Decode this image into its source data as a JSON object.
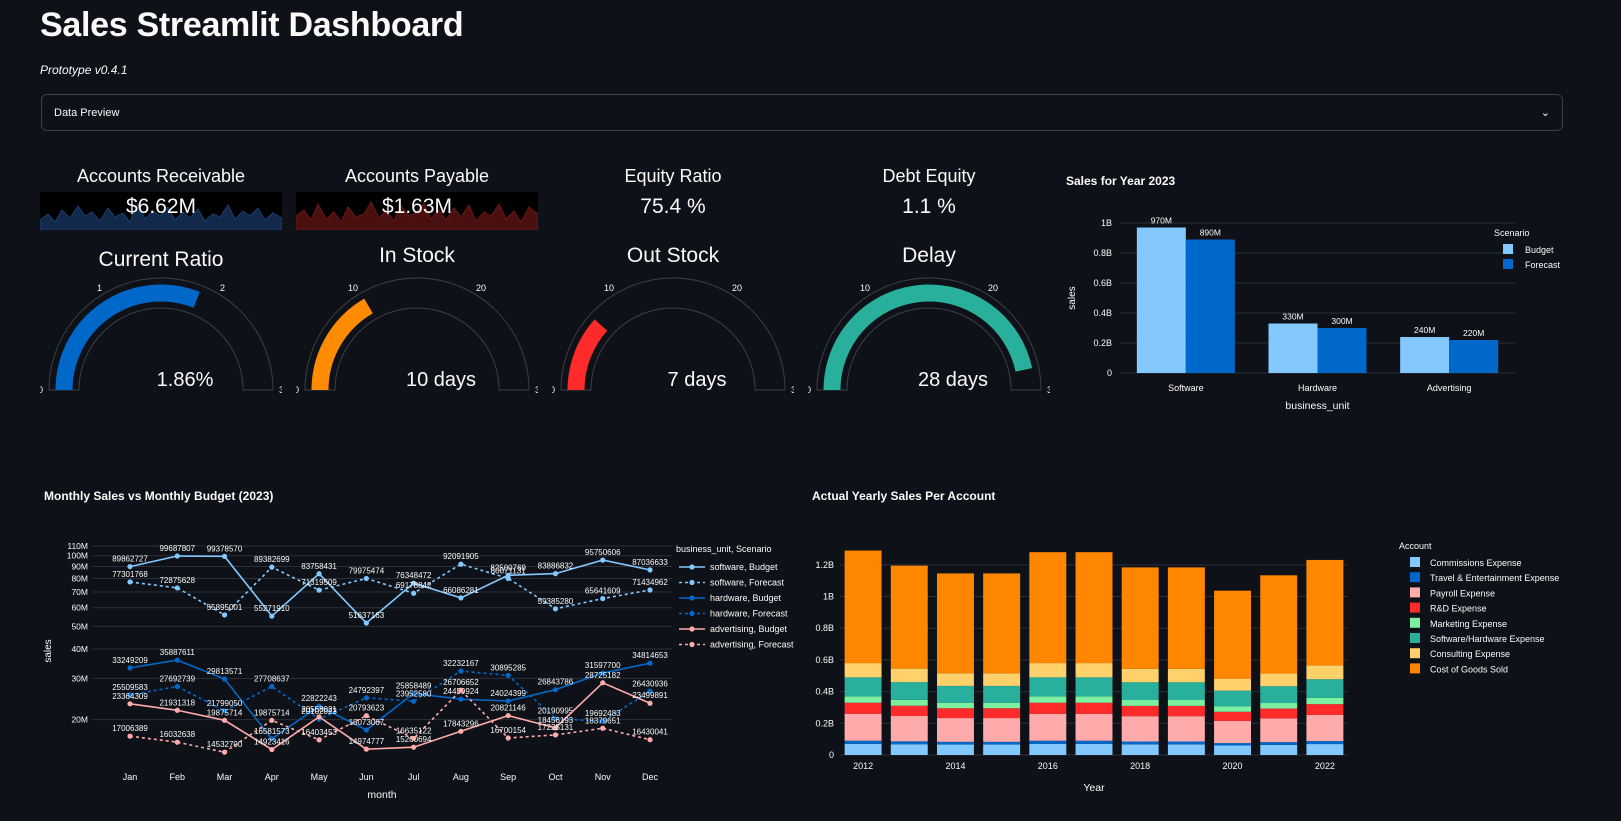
{
  "header": {
    "title": "Sales Streamlit Dashboard",
    "version": "Prototype v0.4.1",
    "expander_label": "Data Preview"
  },
  "kpis": [
    {
      "label": "Accounts Receivable",
      "value": "$6.62M",
      "spark_color": "#1f4e79"
    },
    {
      "label": "Accounts Payable",
      "value": "$1.63M",
      "spark_color": "#7a1a1a"
    },
    {
      "label": "Equity Ratio",
      "value": "75.4 %"
    },
    {
      "label": "Debt Equity",
      "value": "1.1 %"
    }
  ],
  "gauges": [
    {
      "title": "Current Ratio",
      "value_text": "1.86%",
      "value": 1.86,
      "max": 3,
      "color": "#0068c9",
      "ticks": [
        "0",
        "1",
        "2",
        "3"
      ]
    },
    {
      "title": "In Stock",
      "value_text": "10 days",
      "value": 10,
      "max": 30,
      "color": "#ff8c00",
      "ticks": [
        "0",
        "10",
        "20",
        "30"
      ]
    },
    {
      "title": "Out Stock",
      "value_text": "7 days",
      "value": 7,
      "max": 30,
      "color": "#ff2b2b",
      "ticks": [
        "0",
        "10",
        "20",
        "30"
      ]
    },
    {
      "title": "Delay",
      "value_text": "28 days",
      "value": 28,
      "max": 30,
      "color": "#29b09d",
      "ticks": [
        "0",
        "10",
        "20",
        "30"
      ]
    }
  ],
  "chart_data": [
    {
      "type": "bar",
      "title": "Sales for Year 2023",
      "xlabel": "business_unit",
      "ylabel": "sales",
      "categories": [
        "Software",
        "Hardware",
        "Advertising"
      ],
      "ylim": [
        0,
        1000000000
      ],
      "yticks": [
        "0",
        "0.2B",
        "0.4B",
        "0.6B",
        "0.8B",
        "1B"
      ],
      "legend_title": "Scenario",
      "series": [
        {
          "name": "Budget",
          "color": "#83c9ff",
          "values": [
            970000000,
            330000000,
            240000000
          ],
          "labels": [
            "970M",
            "330M",
            "240M"
          ]
        },
        {
          "name": "Forecast",
          "color": "#0068c9",
          "values": [
            890000000,
            300000000,
            220000000
          ],
          "labels": [
            "890M",
            "300M",
            "220M"
          ]
        }
      ]
    },
    {
      "type": "line",
      "title": "Monthly Sales vs Monthly Budget (2023)",
      "xlabel": "month",
      "ylabel": "sales",
      "scale": "log",
      "categories": [
        "Jan",
        "Feb",
        "Mar",
        "Apr",
        "May",
        "Jun",
        "Jul",
        "Aug",
        "Sep",
        "Oct",
        "Nov",
        "Dec"
      ],
      "yticks": [
        "20M",
        "30M",
        "40M",
        "50M",
        "60M",
        "70M",
        "80M",
        "90M",
        "100M",
        "110M"
      ],
      "ylim": [
        14000000,
        110000000
      ],
      "legend_title": "business_unit, Scenario",
      "series": [
        {
          "name": "software, Budget",
          "color": "#83c9ff",
          "dash": false,
          "values": [
            89862727,
            99687807,
            99378570,
            55271910,
            83758431,
            51637163,
            76348472,
            66086281,
            82500769,
            83886832,
            95750606,
            87036633
          ]
        },
        {
          "name": "software, Forecast",
          "color": "#83c9ff",
          "dash": true,
          "values": [
            77301768,
            72875628,
            55895001,
            89382699,
            71319509,
            79975474,
            69178842,
            92091905,
            80071131,
            59385280,
            65641609,
            71434962
          ]
        },
        {
          "name": "hardware, Budget",
          "color": "#0068c9",
          "dash": false,
          "values": [
            33249209,
            35887611,
            29813571,
            16581573,
            22822243,
            18073067,
            25858489,
            24459924,
            24024399,
            26843786,
            31597700,
            34814653
          ]
        },
        {
          "name": "hardware, Forecast",
          "color": "#0068c9",
          "dash": true,
          "values": [
            25509583,
            27692739,
            21799050,
            27708637,
            20102023,
            24792397,
            23952580,
            32232167,
            30895285,
            20190995,
            19692483,
            26430936
          ]
        },
        {
          "name": "advertising, Budget",
          "color": "#ffabab",
          "dash": false,
          "values": [
            23364309,
            21931318,
            19875714,
            14923416,
            20558021,
            14974777,
            15260694,
            17843296,
            20821146,
            18456193,
            28725182,
            23499891
          ]
        },
        {
          "name": "advertising, Forecast",
          "color": "#ffabab",
          "dash": true,
          "values": [
            17006389,
            16032638,
            14532700,
            19875714,
            16403453,
            20793623,
            16635122,
            26706652,
            16700154,
            17225131,
            18379651,
            16430041
          ]
        }
      ]
    },
    {
      "type": "bar",
      "stacked": true,
      "title": "Actual Yearly Sales Per Account",
      "xlabel": "Year",
      "ylabel": "sales",
      "ylim": [
        0,
        1300000000
      ],
      "yticks": [
        "0",
        "0.2B",
        "0.4B",
        "0.6B",
        "0.8B",
        "1B",
        "1.2B"
      ],
      "xticks": [
        "2012",
        "2014",
        "2016",
        "2018",
        "2020",
        "2022"
      ],
      "categories": [
        "2012",
        "2013",
        "2014",
        "2015",
        "2016",
        "2017",
        "2018",
        "2019",
        "2020",
        "2021",
        "2022"
      ],
      "legend_title": "Account",
      "series": [
        {
          "name": "Commissions Expense",
          "color": "#83c9ff",
          "values": [
            70000000,
            68000000,
            66000000,
            66000000,
            70000000,
            70000000,
            67000000,
            67000000,
            60000000,
            64000000,
            69000000
          ]
        },
        {
          "name": "Travel & Entertainment Expense",
          "color": "#0068c9",
          "values": [
            20000000,
            18000000,
            17000000,
            17000000,
            20000000,
            20000000,
            18000000,
            18000000,
            15000000,
            17000000,
            19000000
          ]
        },
        {
          "name": "Payroll Expense",
          "color": "#ffabab",
          "values": [
            170000000,
            160000000,
            150000000,
            150000000,
            170000000,
            170000000,
            160000000,
            160000000,
            140000000,
            150000000,
            165000000
          ]
        },
        {
          "name": "R&D Expense",
          "color": "#ff2b2b",
          "values": [
            70000000,
            65000000,
            62000000,
            62000000,
            70000000,
            70000000,
            65000000,
            65000000,
            58000000,
            62000000,
            68000000
          ]
        },
        {
          "name": "Marketing Expense",
          "color": "#7defa1",
          "values": [
            40000000,
            37000000,
            35000000,
            35000000,
            40000000,
            40000000,
            37000000,
            37000000,
            33000000,
            35000000,
            39000000
          ]
        },
        {
          "name": "Software/Hardware Expense",
          "color": "#29b09d",
          "values": [
            120000000,
            112000000,
            106000000,
            106000000,
            120000000,
            120000000,
            112000000,
            112000000,
            100000000,
            106000000,
            118000000
          ]
        },
        {
          "name": "Consulting Expense",
          "color": "#ffd16a",
          "values": [
            90000000,
            85000000,
            80000000,
            80000000,
            90000000,
            90000000,
            85000000,
            85000000,
            76000000,
            80000000,
            88000000
          ]
        },
        {
          "name": "Cost of Goods Sold",
          "color": "#ff8700",
          "values": [
            710000000,
            650000000,
            630000000,
            630000000,
            700000000,
            700000000,
            640000000,
            640000000,
            555000000,
            620000000,
            665000000
          ]
        }
      ]
    }
  ]
}
